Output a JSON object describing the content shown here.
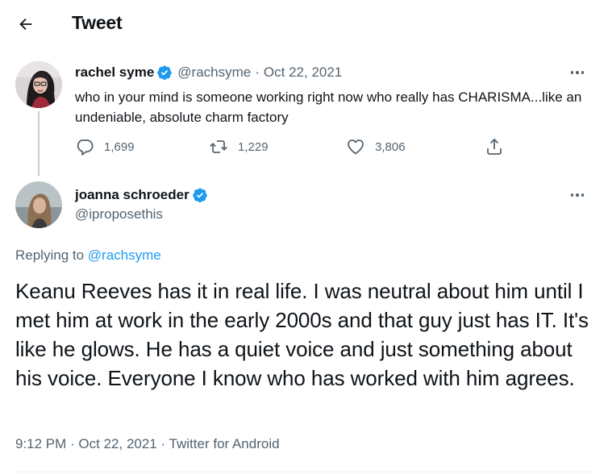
{
  "header": {
    "title": "Tweet",
    "back_icon": "arrow-left-icon"
  },
  "original_tweet": {
    "display_name": "rachel syme",
    "handle": "@rachsyme",
    "separator": "·",
    "date": "Oct 22, 2021",
    "verified": true,
    "text": "who in your mind is someone working right now who really has CHARISMA...like an undeniable, absolute charm factory",
    "replies": "1,699",
    "retweets": "1,229",
    "likes": "3,806"
  },
  "reply_tweet": {
    "display_name": "joanna schroeder",
    "handle": "@iproposethis",
    "verified": true,
    "replying_prefix": "Replying to",
    "replying_to": "@rachsyme",
    "text": "Keanu Reeves has it in real life. I was neutral about him until I met him at work in the early 2000s and that guy just has IT. It's like he glows. He has a quiet voice and just something about his voice. Everyone I know who has worked with him agrees.",
    "meta": "9:12 PM · Oct 22, 2021 · Twitter for Android"
  },
  "colors": {
    "verified_blue": "#1d9bf0",
    "secondary_text": "#536471",
    "primary_text": "#0f1419",
    "link": "#1d9bf0"
  }
}
